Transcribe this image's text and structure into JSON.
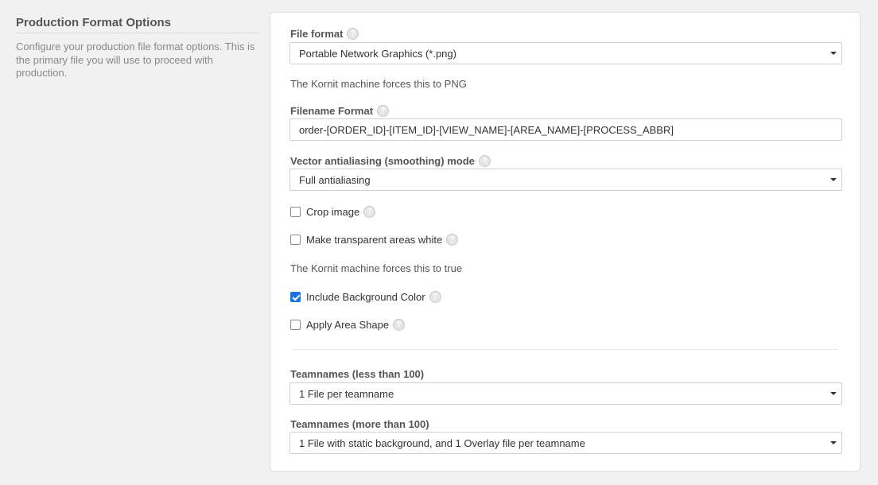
{
  "section": {
    "title": "Production Format Options",
    "description": "Configure your production file format options. This is the primary file you will use to proceed with production."
  },
  "fields": {
    "file_format": {
      "label": "File format",
      "value": "Portable Network Graphics (*.png)",
      "note": "The Kornit machine forces this to PNG"
    },
    "filename_format": {
      "label": "Filename Format",
      "value": "order-[ORDER_ID]-[ITEM_ID]-[VIEW_NAME]-[AREA_NAME]-[PROCESS_ABBR]"
    },
    "antialiasing": {
      "label": "Vector antialiasing (smoothing) mode",
      "value": "Full antialiasing"
    },
    "crop_image": {
      "label": "Crop image",
      "checked": false
    },
    "transparent_white": {
      "label": "Make transparent areas white",
      "checked": false,
      "note": "The Kornit machine forces this to true"
    },
    "background_color": {
      "label": "Include Background Color",
      "checked": true
    },
    "area_shape": {
      "label": "Apply Area Shape",
      "checked": false
    },
    "teamnames_less": {
      "label": "Teamnames (less than 100)",
      "value": "1 File per teamname"
    },
    "teamnames_more": {
      "label": "Teamnames (more than 100)",
      "value": "1 File with static background, and 1 Overlay file per teamname"
    }
  },
  "icons": {
    "help": "help-icon",
    "dropdown": "chevron-down-icon",
    "check": "check-icon"
  },
  "colors": {
    "accent": "#1a73e8",
    "background": "#f1f1f1",
    "panel": "#ffffff"
  }
}
